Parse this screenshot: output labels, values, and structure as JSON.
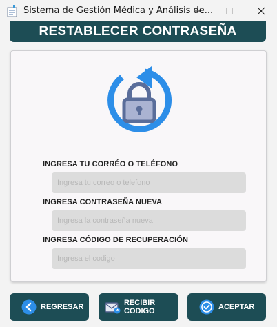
{
  "window": {
    "title": "Sistema de Gestión Médica y Análisis de..."
  },
  "header": {
    "title": "RESTABLECER CONTRASEÑA"
  },
  "form": {
    "email": {
      "label": "INGRESA TU CORRÉO O TELÉFONO",
      "placeholder": "Ingresa tu correo o telefono",
      "value": ""
    },
    "new_password": {
      "label": "INGRESA CONTRASEÑA NUEVA",
      "placeholder": "Ingresa la contraseña nueva",
      "value": ""
    },
    "recovery_code": {
      "label": "INGRESA CÓDIGO DE RECUPERACIÓN",
      "placeholder": "Ingresa el codigo",
      "value": ""
    }
  },
  "buttons": {
    "back_label": "REGRESAR",
    "send_label_line1": "RECIBIR",
    "send_label_line2": "CODIGO",
    "accept_label": "ACEPTAR"
  },
  "icons": {
    "app": "app-icon",
    "minimize": "minimize-icon",
    "maximize": "maximize-icon",
    "close": "close-icon",
    "illustration": "refresh-lock-icon",
    "back": "back-arrow-icon",
    "send": "envelope-icon",
    "accept": "check-circle-icon"
  },
  "colors": {
    "primary": "#1d4d55",
    "accent_blue": "#2d8ee8",
    "lock_body": "#5a6d9a",
    "input_bg": "#dcdcdc",
    "card_bg": "#f9f7f9"
  }
}
